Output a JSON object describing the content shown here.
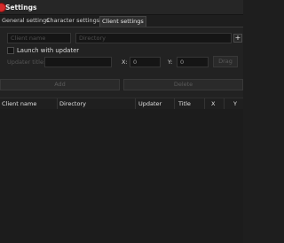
{
  "window": {
    "title": "Settings"
  },
  "tabs": [
    {
      "label": "General settings",
      "active": false
    },
    {
      "label": "Character settings",
      "active": false
    },
    {
      "label": "Client settings",
      "active": true
    }
  ],
  "client_form": {
    "client_name_placeholder": "Client name",
    "directory_placeholder": "Directory",
    "add_directory_symbol": "+",
    "launch_with_updater_label": "Launch with updater",
    "launch_with_updater_checked": false,
    "updater_title_label": "Updater title:",
    "x_label": "X:",
    "x_value": "0",
    "y_label": "Y:",
    "y_value": "0",
    "drag_label": "Drag",
    "add_label": "Add",
    "delete_label": "Delete"
  },
  "clients_table": {
    "columns": [
      "Client name",
      "Directory",
      "Updater",
      "Title",
      "X",
      "Y"
    ],
    "rows": []
  },
  "colors": {
    "background": "#1e1e1e",
    "accent_icon": "#d42a2a",
    "text": "#d8d8d8",
    "disabled_text": "#555555"
  }
}
